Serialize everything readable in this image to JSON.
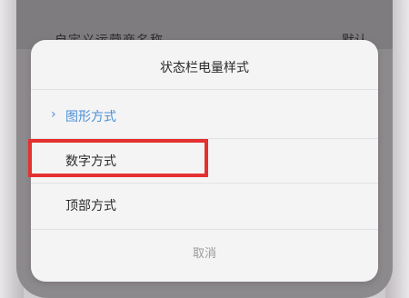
{
  "background": {
    "row_label": "自定义运营商名称",
    "row_value": "默认"
  },
  "dialog": {
    "title": "状态栏电量样式",
    "options": [
      {
        "label": "图形方式",
        "selected": true
      },
      {
        "label": "数字方式",
        "selected": false
      },
      {
        "label": "顶部方式",
        "selected": false
      }
    ],
    "cancel_label": "取消",
    "selected_marker": "›"
  },
  "colors": {
    "accent": "#4a8fd6",
    "highlight_box": "#e53030"
  }
}
